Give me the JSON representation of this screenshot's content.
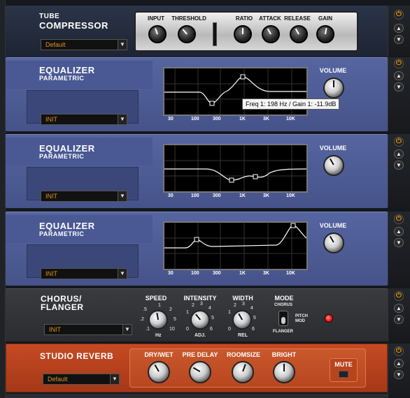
{
  "compressor": {
    "title_line1": "TUBE",
    "title_line2": "COMPRESSOR",
    "preset": "Default",
    "labels": [
      "INPUT",
      "THRESHOLD",
      "RATIO",
      "ATTACK",
      "RELEASE",
      "GAIN"
    ]
  },
  "eq1": {
    "title": "EQUALIZER",
    "subtitle": "PARAMETRIC",
    "preset": "INIT",
    "volume_label": "VOLUME",
    "freq_labels": [
      "30",
      "100",
      "300",
      "1K",
      "3K",
      "10K"
    ],
    "tooltip": "Freq 1:  198 Hz / Gain 1:  -11.9dB"
  },
  "eq2": {
    "title": "EQUALIZER",
    "subtitle": "PARAMETRIC",
    "preset": "INIT",
    "volume_label": "VOLUME",
    "freq_labels": [
      "30",
      "100",
      "300",
      "1K",
      "3K",
      "10K"
    ]
  },
  "eq3": {
    "title": "EQUALIZER",
    "subtitle": "PARAMETRIC",
    "preset": "INIT",
    "volume_label": "VOLUME",
    "freq_labels": [
      "30",
      "100",
      "300",
      "1K",
      "3K",
      "10K"
    ]
  },
  "chorus": {
    "title_line1": "CHORUS/",
    "title_line2": "FLANGER",
    "preset": "INIT",
    "speed_label": "SPEED",
    "speed_unit": "Hz",
    "speed_scale": [
      ".5",
      "1",
      "2",
      ".2",
      "5",
      ".1",
      "10"
    ],
    "intensity_label": "INTENSITY",
    "intensity_unit": "ADJ.",
    "intensity_scale": [
      "2",
      "3",
      "1",
      "4",
      "0",
      "5",
      "6"
    ],
    "width_label": "WIDTH",
    "width_unit": "REL",
    "width_scale": [
      "2",
      "3",
      "1",
      "4",
      "0",
      "5",
      "6"
    ],
    "mode_label": "MODE",
    "mode_options": [
      "CHORUS",
      "PITCH MOD",
      "FLANGER"
    ]
  },
  "reverb": {
    "title": "STUDIO REVERB",
    "preset": "Default",
    "labels": [
      "DRY/WET",
      "PRE DELAY",
      "ROOMSIZE",
      "BRIGHT"
    ],
    "mute_label": "MUTE"
  },
  "colors": {
    "eq_blue": "#4a5a8a",
    "reverb_red": "#b8421c",
    "power": "#f4a000",
    "led": "#ff2020"
  }
}
